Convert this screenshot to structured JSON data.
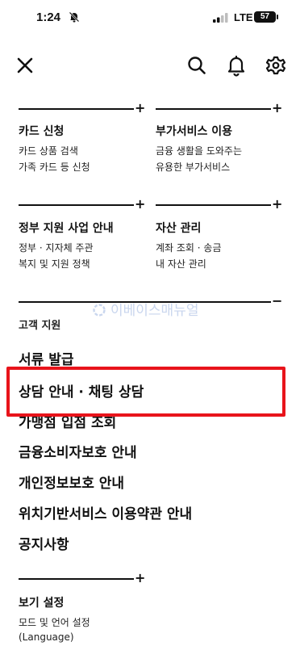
{
  "status_bar": {
    "time": "1:24",
    "network": "LTE",
    "battery": "57"
  },
  "colors": {
    "highlight": "#e8141b",
    "text": "#111111",
    "watermark": "#c9d6ee"
  },
  "cards": [
    {
      "title": "카드 신청",
      "lines": [
        "카드 상품 검색",
        "가족 카드 등 신청"
      ]
    },
    {
      "title": "부가서비스 이용",
      "lines": [
        "금융 생활을 도와주는",
        "유용한 부가서비스"
      ]
    },
    {
      "title": "정부 지원 사업 안내",
      "lines": [
        "정부 · 지자체 주관",
        "복지 및 지원 정책"
      ]
    },
    {
      "title": "자산 관리",
      "lines": [
        "계좌 조회 · 송금",
        "내 자산 관리"
      ]
    }
  ],
  "support": {
    "title": "고객 지원",
    "items": [
      "서류 발급",
      "상담 안내 · 채팅 상담",
      "가맹점 입점 조회",
      "금융소비자보호 안내",
      "개인정보보호 안내",
      "위치기반서비스 이용약관 안내",
      "공지사항"
    ]
  },
  "view_settings": {
    "title": "보기 설정",
    "lines": [
      "모드 및 언어 설정",
      "(Language)"
    ]
  },
  "watermark": "이베이스매뉴얼",
  "signs": {
    "plus": "+",
    "minus": "−"
  },
  "icons": {
    "close": "close-icon",
    "search": "search-icon",
    "bell": "bell-icon",
    "gear": "gear-icon"
  }
}
